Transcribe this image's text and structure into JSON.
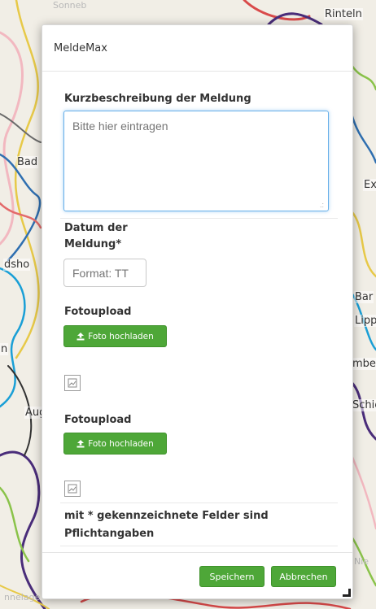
{
  "map": {
    "labels": [
      "Rinteln",
      "Bad",
      "Ex",
      "dsho",
      "Bar",
      "Lipp",
      "n",
      "mber",
      "Aug",
      "Schie",
      "Nie",
      "nnelage",
      "Sonneb"
    ]
  },
  "dialog": {
    "title": "MeldeMax",
    "short_description": {
      "label": "Kurzbeschreibung der Meldung",
      "placeholder": "Bitte hier eintragen",
      "value": ""
    },
    "date": {
      "label_line1": "Datum der",
      "label_line2": "Meldung*",
      "placeholder": "Format: TT",
      "value": ""
    },
    "photo_uploads": [
      {
        "label": "Fotoupload",
        "button_label": "Foto hochladen",
        "icon": "upload-icon",
        "preview_icon": "broken-image-icon"
      },
      {
        "label": "Fotoupload",
        "button_label": "Foto hochladen",
        "icon": "upload-icon",
        "preview_icon": "broken-image-icon"
      }
    ],
    "required_note": "mit * gekennzeichnete Felder sind Pflichtangaben",
    "footer": {
      "save_label": "Speichern",
      "cancel_label": "Abbrechen"
    }
  },
  "colors": {
    "primary_green": "#4ea738",
    "focus_blue": "#66afe9"
  }
}
